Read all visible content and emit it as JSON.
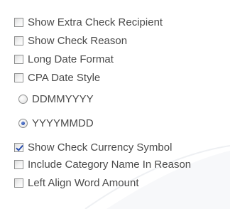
{
  "options": [
    {
      "type": "checkbox",
      "label": "Show Extra Check Recipient",
      "checked": false
    },
    {
      "type": "checkbox",
      "label": "Show Check Reason",
      "checked": false
    },
    {
      "type": "checkbox",
      "label": "Long Date Format",
      "checked": false
    },
    {
      "type": "checkbox",
      "label": "CPA Date Style",
      "checked": false
    },
    {
      "type": "radio",
      "label": "DDMMYYYY",
      "checked": false
    },
    {
      "type": "radio",
      "label": "YYYYMMDD",
      "checked": true
    },
    {
      "type": "checkbox",
      "label": "Show Check Currency Symbol",
      "checked": true
    },
    {
      "type": "checkbox",
      "label": "Include Category Name In Reason",
      "checked": false
    },
    {
      "type": "checkbox",
      "label": "Left Align Word Amount",
      "checked": false
    }
  ],
  "colors": {
    "text": "#4b4b4b",
    "control_border": "#8e8f8f",
    "check_mark": "#2a4fb0",
    "radio_dot": "#2a4fb0"
  }
}
